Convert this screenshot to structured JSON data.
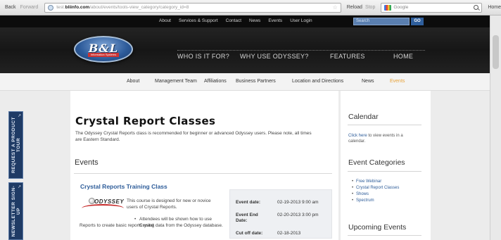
{
  "browser": {
    "back": "Back",
    "forward": "Forward",
    "url_prefix": "test.",
    "url_domain": "bliinfo.com",
    "url_path": "/about/events/tools-view_category/category_id=8",
    "reload": "Reload",
    "stop": "Stop",
    "search_engine": "Google",
    "home": "Home"
  },
  "header": {
    "util_links": [
      "About",
      "Services & Support",
      "Contact",
      "News",
      "Events",
      "User Login"
    ],
    "search_placeholder": "Search",
    "search_go": "GO",
    "logo_text": "B&L",
    "logo_sub": "Information Systems",
    "main_nav": [
      "WHO IS IT FOR?",
      "WHY USE ODYSSEY?",
      "FEATURES",
      "HOME"
    ]
  },
  "sub_nav": {
    "items": [
      "About",
      "Management Team",
      "Affiliations",
      "Business Partners",
      "Location and Directions",
      "News",
      "Events"
    ],
    "active": "Events"
  },
  "main": {
    "title": "Crystal Report Classes",
    "intro": "The Odyssey Crystal Reports class is recommended for beginner or advanced Odyssey users.  Please note, all times are Eastern Standard.",
    "events_heading": "Events",
    "event": {
      "title": "Crystal Reports Training Class",
      "logo_text": "ODYSSEY",
      "desc1": "This course is designed for new or novice users of Crystal Reports.",
      "bullet": "Attendees will be shown how to use Crystal",
      "desc2": "Reports to create basic reports using data from the Odyssey database.",
      "details": [
        {
          "label": "Event date:",
          "value": "02-19-2013 9:00 am"
        },
        {
          "label": "Event End Date:",
          "value": "02-20-2013 3:00 pm"
        },
        {
          "label": "Cut off date:",
          "value": "02-18-2013"
        }
      ]
    }
  },
  "sidebar": {
    "calendar_heading": "Calendar",
    "calendar_link": "Click here",
    "calendar_text": " to view events in a calendar.",
    "categories_heading": "Event Categories",
    "categories": [
      "Free Webinar",
      "Crystal Report Classes",
      "Shows",
      "Spectrum"
    ],
    "upcoming_heading": "Upcoming Events"
  },
  "tabs": {
    "tour": "REQUEST A PRODUCT TOUR",
    "newsletter": "NEWSLETTER SIGN-UP"
  },
  "colors": {
    "link_blue": "#2d5c99",
    "active_orange": "#e8a33a",
    "tab_navy": "#1f3b65"
  }
}
